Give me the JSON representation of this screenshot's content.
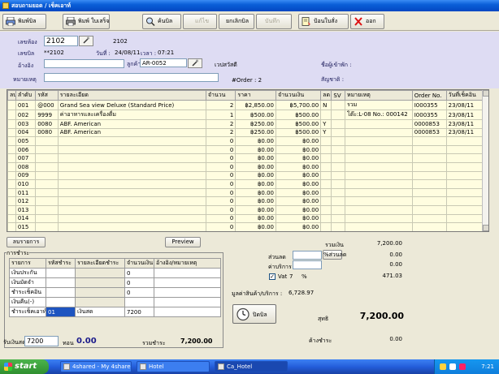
{
  "window": {
    "title": "สอบถามยอด / เช็คเอาท์"
  },
  "toolbar": {
    "print_bill": "พิมพ์บิล",
    "print_receipt": "พิมพ์ ใบเสร็จ",
    "search_bill": "ค้นบิล",
    "edit": "แก้ไข",
    "cancel_bill": "ยกเลิกบิล",
    "save": "บันทึก",
    "enter_order": "ป้อนใบสั่ง",
    "exit": "ออก"
  },
  "header": {
    "room_label": "เลขห้อง",
    "room_value": "2102",
    "room_display": "2102",
    "bill_label": "เลขบิล",
    "bill_value": "**2102",
    "date_label": "วันที่ :",
    "date_value": "24/08/11",
    "time_label": "เวลา :",
    "time_value": "07:21",
    "ref_label": "อ้างอิง",
    "ref_value": "",
    "customer_label": "ลูกค้า",
    "customer_value": "AR-0052",
    "customer_name": "เวปสวัสดี",
    "note_label": "หมายเหตุ",
    "note_value": "",
    "order_count": "#Order : 2",
    "guest_name_label": "ชื่อผู้เข้าพัก :",
    "nationality_label": "สัญชาติ :"
  },
  "grid": {
    "columns": [
      "ลบ",
      "ลำดับ",
      "รหัส",
      "รายละเอียด",
      "จำนวน",
      "ราคา",
      "จำนวนเงิน",
      "ลด",
      "SV",
      "หมายเหตุ",
      "Order No.",
      "วันที่เช็คอิน"
    ],
    "rows": [
      [
        "",
        "001",
        "@000",
        "Grand Sea view Deluxe (Standard Price)",
        "2",
        "฿2,850.00",
        "฿5,700.00",
        "N",
        "",
        "รวม",
        "I000355",
        "23/08/11"
      ],
      [
        "",
        "002",
        "9999",
        "ค่าอาหารและเครื่องดื่ม",
        "1",
        "฿500.00",
        "฿500.00",
        "",
        "",
        "โต๊ะ:L-08 No.: 000142",
        "I000355",
        "23/08/11"
      ],
      [
        "",
        "003",
        "0080",
        "ABF. American",
        "2",
        "฿250.00",
        "฿500.00",
        "Y",
        "",
        "",
        "0000853",
        "23/08/11"
      ],
      [
        "",
        "004",
        "0080",
        "ABF. American",
        "2",
        "฿250.00",
        "฿500.00",
        "Y",
        "",
        "",
        "0000853",
        "23/08/11"
      ],
      [
        "",
        "005",
        "",
        "",
        "0",
        "฿0.00",
        "฿0.00",
        "",
        "",
        "",
        "",
        ""
      ],
      [
        "",
        "006",
        "",
        "",
        "0",
        "฿0.00",
        "฿0.00",
        "",
        "",
        "",
        "",
        ""
      ],
      [
        "",
        "007",
        "",
        "",
        "0",
        "฿0.00",
        "฿0.00",
        "",
        "",
        "",
        "",
        ""
      ],
      [
        "",
        "008",
        "",
        "",
        "0",
        "฿0.00",
        "฿0.00",
        "",
        "",
        "",
        "",
        ""
      ],
      [
        "",
        "009",
        "",
        "",
        "0",
        "฿0.00",
        "฿0.00",
        "",
        "",
        "",
        "",
        ""
      ],
      [
        "",
        "010",
        "",
        "",
        "0",
        "฿0.00",
        "฿0.00",
        "",
        "",
        "",
        "",
        ""
      ],
      [
        "",
        "011",
        "",
        "",
        "0",
        "฿0.00",
        "฿0.00",
        "",
        "",
        "",
        "",
        ""
      ],
      [
        "",
        "012",
        "",
        "",
        "0",
        "฿0.00",
        "฿0.00",
        "",
        "",
        "",
        "",
        ""
      ],
      [
        "",
        "013",
        "",
        "",
        "0",
        "฿0.00",
        "฿0.00",
        "",
        "",
        "",
        "",
        ""
      ],
      [
        "",
        "014",
        "",
        "",
        "0",
        "฿0.00",
        "฿0.00",
        "",
        "",
        "",
        "",
        ""
      ],
      [
        "",
        "015",
        "",
        "",
        "0",
        "฿0.00",
        "฿0.00",
        "",
        "",
        "",
        "",
        ""
      ]
    ]
  },
  "actions": {
    "delete_item": "ลบรายการ",
    "preview": "Preview"
  },
  "payment": {
    "frame_label": "การชำระ",
    "columns": [
      "รายการ",
      "รหัสชำระ",
      "รายละเอียดชำระ",
      "จำนวนเงิน",
      "อ้างอิง/หมายเหตุ"
    ],
    "rows": [
      [
        "เงินประกัน",
        "",
        "",
        "0",
        ""
      ],
      [
        "เงินมัดจำ",
        "",
        "",
        "0",
        ""
      ],
      [
        "ชำระเช็คอิน",
        "",
        "",
        "0",
        ""
      ],
      [
        "เงินคืน(-)",
        "",
        "",
        "",
        ""
      ],
      [
        "ชำระเช็คเอาท์",
        "01",
        "เงินสด",
        "7200",
        ""
      ]
    ],
    "received_label": "รับเงินสด",
    "received_value": "7200",
    "change_label": "ทอน",
    "change_value": "0.00",
    "total_label": "รวมชำระ",
    "total_value": "7,200.00"
  },
  "summary": {
    "subtotal_label": "รวมเงิน",
    "subtotal_value": "7,200.00",
    "discount_label": "ส่วนลด",
    "discount_percent_btn": "%ส่วนลด",
    "discount_value": "0.00",
    "service_label": "ค่าบริการ",
    "service_value": "0.00",
    "vat_label": "Vat",
    "vat_rate": "7",
    "vat_percent": "%",
    "vat_value": "471.03",
    "net_before_vat_label": "มูลค่าสินค้า/บริการ :",
    "net_before_vat_value": "6,728.97",
    "close_bill_button": "ปิดบิล",
    "net_label": "สุทธิ",
    "net_value": "7,200.00",
    "outstanding_label": "ค้างชำระ",
    "outstanding_value": "0.00"
  },
  "taskbar": {
    "start": "start",
    "tasks": [
      "4shared - My 4share...",
      "Hotel",
      "Ca_Hotel"
    ],
    "clock": "7:21"
  }
}
